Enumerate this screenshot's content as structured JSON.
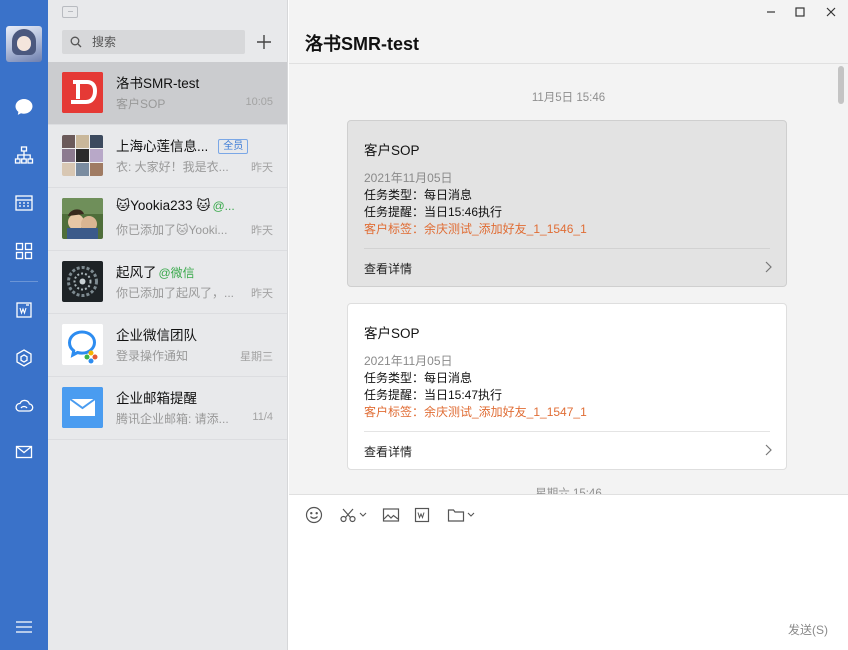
{
  "search": {
    "placeholder": "搜索"
  },
  "conversations": [
    {
      "name": "洛书SMR-test",
      "preview": "客户SOP",
      "time": "10:05"
    },
    {
      "name": "上海心莲信息...",
      "badge": "全员",
      "preview": "衣: 大家好！我是衣...",
      "time": "昨天"
    },
    {
      "name": "🐱Yookia233 🐱",
      "wx_tag": "@...",
      "preview": "你已添加了🐱Yooki...",
      "time": "昨天"
    },
    {
      "name": "起风了",
      "wx_tag": "@微信",
      "preview": "你已添加了起风了，...",
      "time": "昨天"
    },
    {
      "name": "企业微信团队",
      "preview": "登录操作通知",
      "time": "星期三"
    },
    {
      "name": "企业邮箱提醒",
      "preview": "腾讯企业邮箱: 请添...",
      "time": "11/4"
    }
  ],
  "chat": {
    "title": "洛书SMR-test",
    "timestamp_1": "11月5日 15:46",
    "timestamp_2": "星期六 15:46",
    "cards": [
      {
        "title": "客户SOP",
        "date": "2021年11月05日",
        "task_type": "任务类型：每日消息",
        "task_reminder": "任务提醒：当日15:46执行",
        "customer_tag": "客户标签：余庆测试_添加好友_1_1546_1",
        "footer": "查看详情"
      },
      {
        "title": "客户SOP",
        "date": "2021年11月05日",
        "task_type": "任务类型：每日消息",
        "task_reminder": "任务提醒：当日15:47执行",
        "customer_tag": "客户标签：余庆测试_添加好友_1_1547_1",
        "footer": "查看详情"
      }
    ]
  },
  "composer": {
    "send_label": "发送(S)"
  },
  "colors": {
    "rail": "#3a72c9",
    "accent_tag": "#e06d35",
    "member_badge": "#3a7ad6",
    "wx_tag": "#39a94b"
  }
}
